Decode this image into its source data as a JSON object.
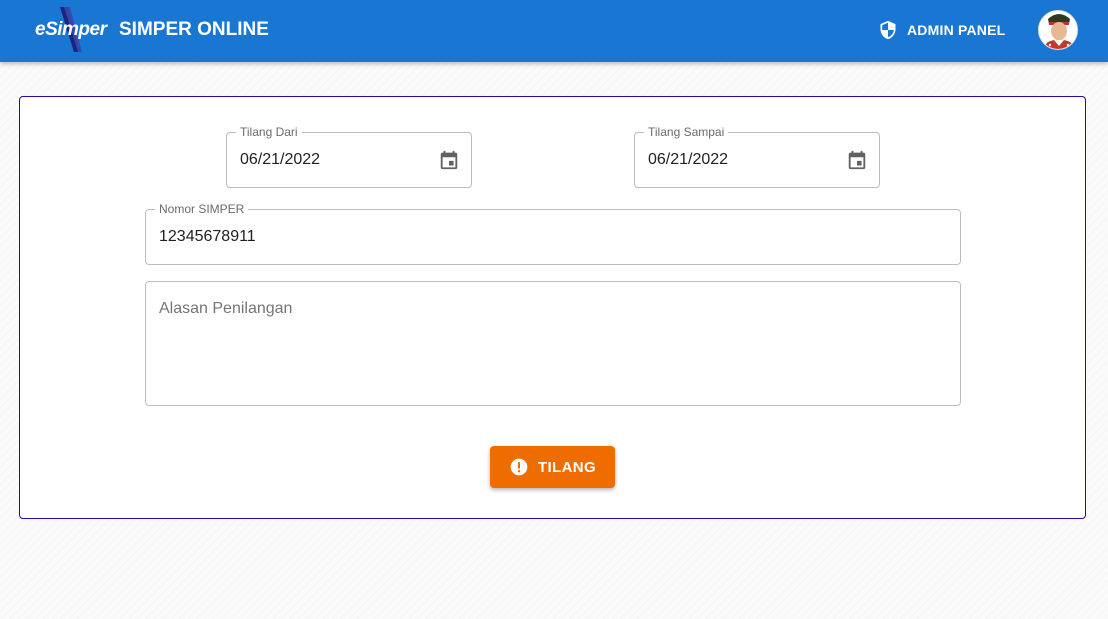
{
  "header": {
    "logo_text": "eSimper",
    "app_title": "SIMPER ONLINE",
    "admin_label": "ADMIN PANEL",
    "admin_icon": "shield-icon",
    "avatar_icon": "user-avatar",
    "bar_color": "#1976d2"
  },
  "form": {
    "tilang_dari": {
      "label": "Tilang Dari",
      "value": "06/21/2022",
      "icon": "calendar-icon"
    },
    "tilang_sampai": {
      "label": "Tilang Sampai",
      "value": "06/21/2022",
      "icon": "calendar-icon"
    },
    "nomor_simper": {
      "label": "Nomor SIMPER",
      "value": "12345678911"
    },
    "alasan": {
      "placeholder": "Alasan Penilangan",
      "value": ""
    },
    "submit": {
      "label": "TILANG",
      "icon": "alert-circle-icon",
      "color": "#ef6c00"
    }
  }
}
